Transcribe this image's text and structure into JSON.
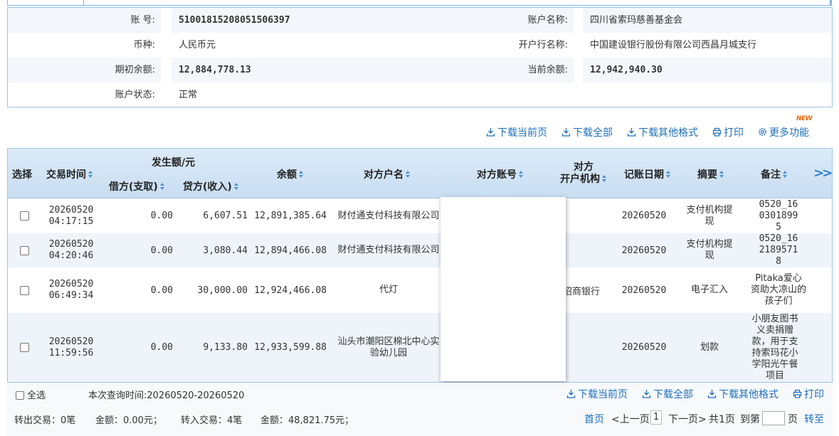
{
  "account": {
    "number_label": "账 号:",
    "number": "51001815208051506397",
    "name_label": "账户名称:",
    "name": "四川省索玛慈善基金会",
    "currency_label": "币种:",
    "currency": "人民币元",
    "bank_label": "开户行名称:",
    "bank": "中国建设银行股份有限公司西昌月城支行",
    "opening_balance_label": "期初余额:",
    "opening_balance": "12,884,778.13",
    "current_balance_label": "当前余额:",
    "current_balance": "12,942,940.30",
    "status_label": "账户状态:",
    "status": "正常"
  },
  "toolbar": {
    "download_page": "下载当前页",
    "download_all": "下载全部",
    "download_other": "下载其他格式",
    "print": "打印",
    "more": "更多功能",
    "new_badge": "NEW"
  },
  "table": {
    "headers": {
      "select": "选择",
      "time": "交易时间",
      "amount_group": "发生额/元",
      "debit": "借方(支取)",
      "credit": "贷方(收入)",
      "balance": "余额",
      "counterparty_name": "对方户名",
      "counterparty_account": "对方账号",
      "counterparty_bank_l1": "对方",
      "counterparty_bank_l2": "开户机构",
      "post_date": "记账日期",
      "summary": "摘要",
      "remark": "备注",
      "more": ">>"
    },
    "rows": [
      {
        "date": "20260520",
        "time": "04:17:15",
        "debit": "0.00",
        "credit": "6,607.51",
        "balance": "12,891,385.64",
        "name": "财付通支付科技有限公司",
        "bank": "",
        "post_date": "20260520",
        "summary": "支付机构提现",
        "remark": "0520_1603018995"
      },
      {
        "date": "20260520",
        "time": "04:20:46",
        "debit": "0.00",
        "credit": "3,080.44",
        "balance": "12,894,466.08",
        "name": "财付通支付科技有限公司",
        "bank": "",
        "post_date": "20260520",
        "summary": "支付机构提现",
        "remark": "0520_1621895718"
      },
      {
        "date": "20260520",
        "time": "06:49:34",
        "debit": "0.00",
        "credit": "30,000.00",
        "balance": "12,924,466.08",
        "name": "代灯",
        "bank": "招商银行",
        "post_date": "20260520",
        "summary": "电子汇入",
        "remark": "Pitaka爱心资助大凉山的孩子们"
      },
      {
        "date": "20260520",
        "time": "11:59:56",
        "debit": "0.00",
        "credit": "9,133.80",
        "balance": "12,933,599.88",
        "name": "汕头市潮阳区棉北中心实验幼儿园",
        "bank": "",
        "post_date": "20260520",
        "summary": "划款",
        "remark": "小朋友图书义卖捐赠款，用于支持索玛花小学阳光午餐项目"
      }
    ]
  },
  "footer": {
    "select_all": "全选",
    "query_time": "本次查询时间:20260520-20260520",
    "download_page": "下载当前页",
    "download_all": "下载全部",
    "download_other": "下载其他格式",
    "print": "打印",
    "out_tx": "转出交易：0笔",
    "out_amount": "金额：0.00元；",
    "in_tx": "转入交易：4笔",
    "in_amount": "金额：48,821.75元；",
    "first": "首页",
    "prev": "<上一页",
    "page": "1",
    "next": "下一页>",
    "total": "共1页",
    "goto": "到第",
    "page_unit": "页",
    "go": "转至"
  },
  "colors": {
    "link": "#1f6fb8",
    "header_bg": "#c9def2",
    "border": "#9ec5e6",
    "new_badge": "#e8690d"
  }
}
